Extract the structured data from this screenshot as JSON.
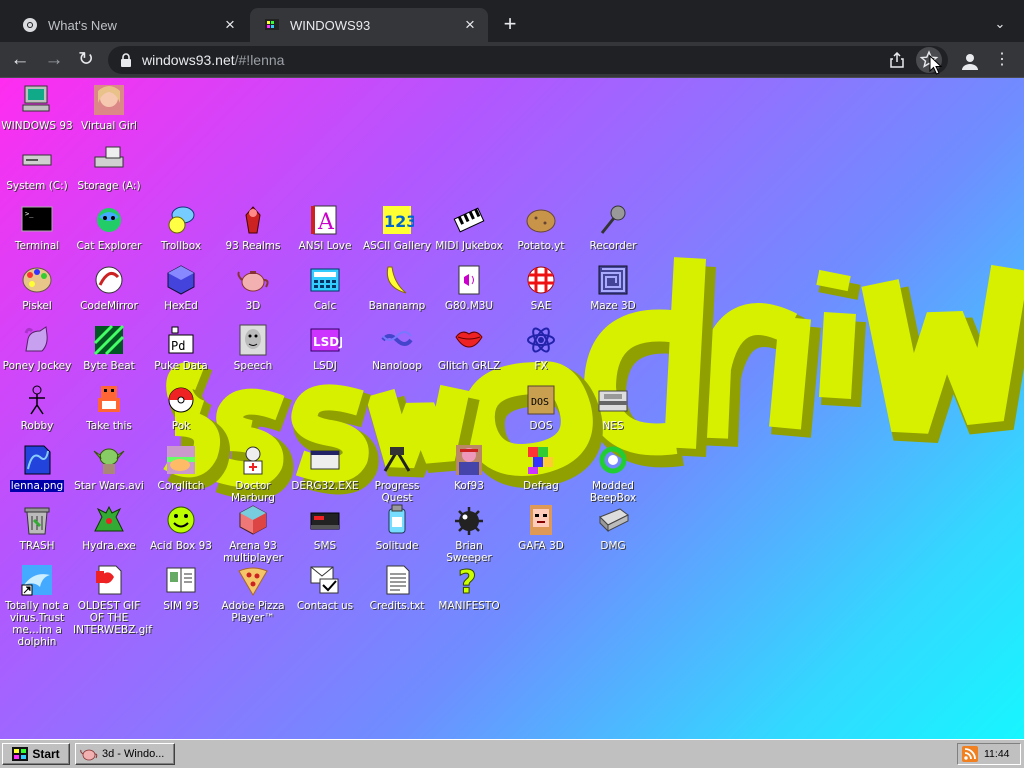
{
  "browser": {
    "tabs": [
      {
        "title": "What's New",
        "icon": "chrome-icon",
        "active": false
      },
      {
        "title": "WINDOWS93",
        "icon": "windows93-favicon",
        "active": true
      }
    ],
    "new_tab_label": "+",
    "tab_menu_label": "⌄",
    "url_host": "windows93.net",
    "url_path": "/#!lenna",
    "back_label": "←",
    "forward_label": "→",
    "reload_label": "↻",
    "menu_label": "⋮",
    "colors": {
      "chrome_dark": "#202124",
      "toolbar": "#35363a",
      "text": "#e8eaed"
    }
  },
  "desktop": {
    "gradient": [
      "#ff2cf0",
      "#b257ff",
      "#6f8dff",
      "#33d8ff",
      "#17f6ff"
    ],
    "icons": [
      {
        "label": "WINDOWS 93",
        "icon": "computer-icon"
      },
      {
        "label": "Virtual Girl",
        "icon": "virtual-girl-icon"
      },
      {
        "label": "System (C:)",
        "icon": "drive-c-icon"
      },
      {
        "label": "Storage (A:)",
        "icon": "floppy-drive-icon"
      },
      {
        "label": "Terminal",
        "icon": "terminal-icon"
      },
      {
        "label": "Cat Explorer",
        "icon": "cat-explorer-icon"
      },
      {
        "label": "Trollbox",
        "icon": "trollbox-icon"
      },
      {
        "label": "93 Realms",
        "icon": "93-realms-icon"
      },
      {
        "label": "ANSI Love",
        "icon": "ansi-love-icon"
      },
      {
        "label": "ASCII Gallery",
        "icon": "ascii-gallery-icon"
      },
      {
        "label": "MIDI Jukebox",
        "icon": "midi-jukebox-icon"
      },
      {
        "label": "Potato.yt",
        "icon": "potato-icon"
      },
      {
        "label": "Recorder",
        "icon": "microphone-icon"
      },
      {
        "label": "Piskel",
        "icon": "palette-icon"
      },
      {
        "label": "CodeMirror",
        "icon": "codemirror-icon"
      },
      {
        "label": "HexEd",
        "icon": "hexed-icon"
      },
      {
        "label": "3D",
        "icon": "teapot-icon"
      },
      {
        "label": "Calc",
        "icon": "calculator-icon"
      },
      {
        "label": "Bananamp",
        "icon": "banana-icon"
      },
      {
        "label": "G80.M3U",
        "icon": "audio-file-icon"
      },
      {
        "label": "SAE",
        "icon": "sae-ball-icon"
      },
      {
        "label": "Maze 3D",
        "icon": "maze-icon"
      },
      {
        "label": "Poney Jockey",
        "icon": "pony-icon"
      },
      {
        "label": "Byte Beat",
        "icon": "byte-beat-icon"
      },
      {
        "label": "Puke Data",
        "icon": "puke-data-icon"
      },
      {
        "label": "Speech",
        "icon": "speech-icon"
      },
      {
        "label": "LSDJ",
        "icon": "lsdj-icon"
      },
      {
        "label": "Nanoloop",
        "icon": "nanoloop-icon"
      },
      {
        "label": "Glitch GRLZ",
        "icon": "lips-icon"
      },
      {
        "label": "FX",
        "icon": "atom-icon"
      },
      {
        "label": "Robby",
        "icon": "stick-figure-icon"
      },
      {
        "label": "Take this",
        "icon": "take-this-icon"
      },
      {
        "label": "Pok",
        "icon": "pokemon-icon"
      },
      {
        "label": "DOS",
        "icon": "dos-icon"
      },
      {
        "label": "NES",
        "icon": "nes-icon"
      },
      {
        "label": "lenna.png",
        "icon": "image-file-icon",
        "selected": true
      },
      {
        "label": "Star Wars.avi",
        "icon": "yoda-icon"
      },
      {
        "label": "Corglitch",
        "icon": "corglitch-icon"
      },
      {
        "label": "Doctor Marburg",
        "icon": "doctor-icon"
      },
      {
        "label": "DERG32.EXE",
        "icon": "derg-icon"
      },
      {
        "label": "Progress Quest",
        "icon": "progress-quest-icon"
      },
      {
        "label": "Kof93",
        "icon": "fighter-icon"
      },
      {
        "label": "Defrag",
        "icon": "defrag-icon"
      },
      {
        "label": "Modded BeepBox",
        "icon": "beepbox-icon"
      },
      {
        "label": "TRASH",
        "icon": "trash-icon"
      },
      {
        "label": "Hydra.exe",
        "icon": "hydra-icon"
      },
      {
        "label": "Acid Box 93",
        "icon": "smiley-icon"
      },
      {
        "label": "Arena 93 multiplayer",
        "icon": "cube-icon"
      },
      {
        "label": "SMS",
        "icon": "sms-console-icon"
      },
      {
        "label": "Solitude",
        "icon": "solitude-icon"
      },
      {
        "label": "Brian Sweeper",
        "icon": "mine-icon"
      },
      {
        "label": "GAFA 3D",
        "icon": "gafa-face-icon"
      },
      {
        "label": "DMG",
        "icon": "dmg-icon"
      },
      {
        "label": "Totally not a virus.Trust me...im a dolphin",
        "icon": "dolphin-icon"
      },
      {
        "label": "OLDEST GIF OF THE INTERWEBZ.gif",
        "icon": "gif-file-icon"
      },
      {
        "label": "SIM 93",
        "icon": "sim-icon"
      },
      {
        "label": "Adobe Pizza Player™",
        "icon": "pizza-icon"
      },
      {
        "label": "Contact us",
        "icon": "contact-icon"
      },
      {
        "label": "Credits.txt",
        "icon": "text-file-icon"
      },
      {
        "label": "MANIFESTO",
        "icon": "question-mark-icon"
      }
    ],
    "banner_text": "Windows93",
    "banner_color": "#d7f000"
  },
  "taskbar": {
    "start_label": "Start",
    "task_label": "3d - Windo...",
    "clock": "11:44",
    "colors": {
      "face": "#c0c0c0"
    }
  }
}
